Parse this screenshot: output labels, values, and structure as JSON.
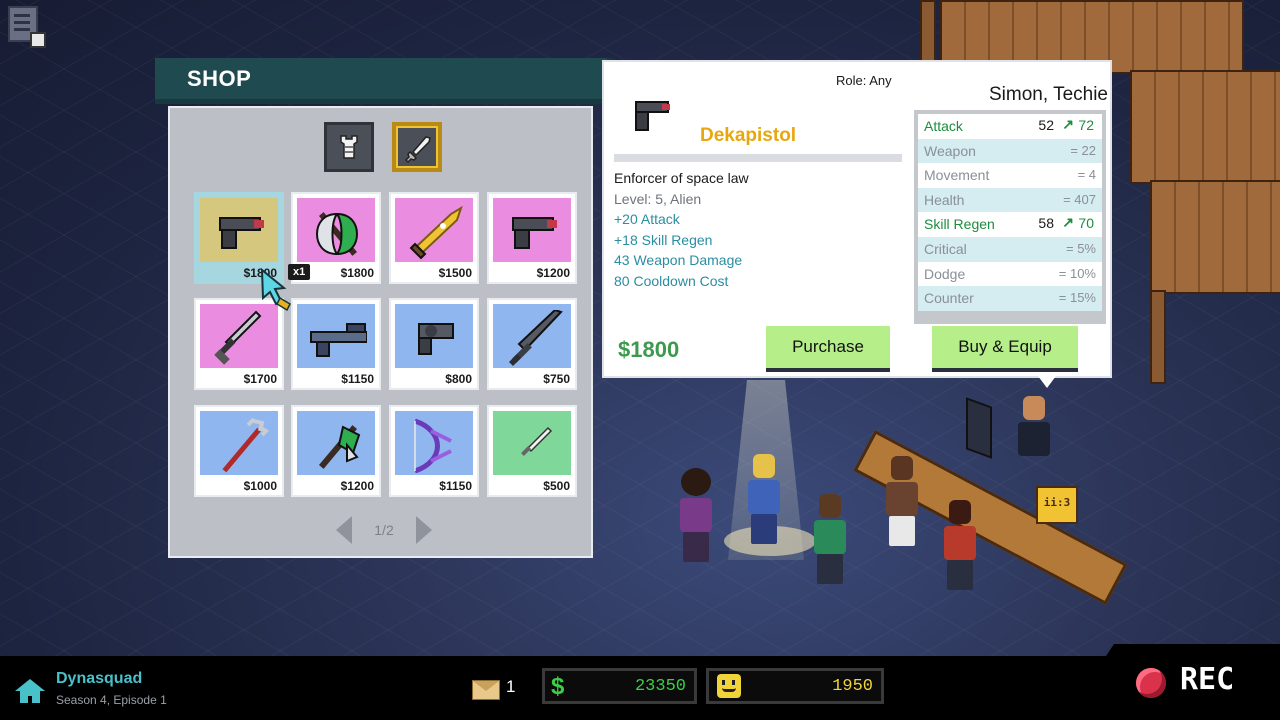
{
  "shop": {
    "title": "SHOP",
    "categories": [
      {
        "name": "armor-icon",
        "selected": false
      },
      {
        "name": "weapon-icon",
        "selected": true
      }
    ],
    "items": [
      {
        "icon": "pistol-icon",
        "price": "$1800",
        "bg": "#d6c77e",
        "selected": true
      },
      {
        "icon": "battle-axe-icon",
        "price": "$1800",
        "bg": "#ea8de0"
      },
      {
        "icon": "golden-sword-icon",
        "price": "$1500",
        "bg": "#ea8de0"
      },
      {
        "icon": "pistol-icon",
        "price": "$1200",
        "bg": "#ea8de0"
      },
      {
        "icon": "dagger-icon",
        "price": "$1700",
        "bg": "#ea8de0"
      },
      {
        "icon": "rifle-icon",
        "price": "$1150",
        "bg": "#8fb6ef"
      },
      {
        "icon": "revolver-icon",
        "price": "$800",
        "bg": "#8fb6ef"
      },
      {
        "icon": "long-sword-icon",
        "price": "$750",
        "bg": "#8fb6ef"
      },
      {
        "icon": "trident-icon",
        "price": "$1000",
        "bg": "#8fb6ef"
      },
      {
        "icon": "green-axe-icon",
        "price": "$1200",
        "bg": "#8fb6ef"
      },
      {
        "icon": "bow-icon",
        "price": "$1150",
        "bg": "#8fb6ef"
      },
      {
        "icon": "knife-icon",
        "price": "$500",
        "bg": "#7fd89a"
      }
    ],
    "selected_price_visible": "$18",
    "quantity_badge": "x1",
    "pager": "1/2"
  },
  "detail": {
    "role": "Role: Any",
    "item_name": "Dekapistol",
    "description": "Enforcer of space law",
    "level": "Level: 5, Alien",
    "bonuses": [
      "+20 Attack",
      "+18 Skill Regen",
      "43 Weapon Damage",
      "80 Cooldown Cost"
    ],
    "cost": "$1800",
    "purchase_label": "Purchase",
    "buy_equip_label": "Buy & Equip",
    "character": "Simon, Techie",
    "stats": [
      {
        "name": "Attack",
        "old": "52",
        "new": "72",
        "up": true
      },
      {
        "name": "Weapon",
        "value": "= 22"
      },
      {
        "name": "Movement",
        "value": "= 4"
      },
      {
        "name": "Health",
        "value": "= 407"
      },
      {
        "name": "Skill Regen",
        "old": "58",
        "new": "70",
        "up": true
      },
      {
        "name": "Critical",
        "value": "= 5%"
      },
      {
        "name": "Dodge",
        "value": "= 10%"
      },
      {
        "name": "Counter",
        "value": "= 15%"
      }
    ]
  },
  "hud": {
    "team_name": "Dynasquad",
    "season": "Season 4, Episode 1",
    "mail_count": "1",
    "currency_symbol": "$",
    "money": "23350",
    "fans": "1950",
    "rec_label": "REC"
  },
  "scene": {
    "sign_text": "ii:3"
  },
  "colors": {
    "shop_header": "#1f4b50",
    "accent_gold": "#e8a70f",
    "button_green": "#b6ef8a",
    "stat_up": "#1c8d3c",
    "money_green": "#3bcf45",
    "fans_yellow": "#f1d43a",
    "rec_red": "#d9324a"
  }
}
